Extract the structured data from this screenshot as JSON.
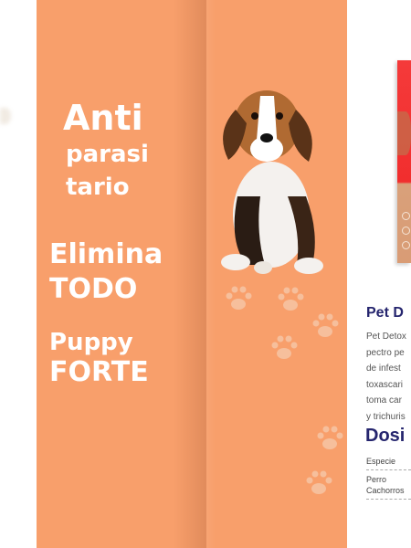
{
  "left_panel": {
    "headline_1": "Anti",
    "headline_2": "parasi",
    "headline_3": "tario",
    "headline_4": "Elimina",
    "headline_5": "TODO",
    "headline_6": "Puppy",
    "headline_7": "FORTE",
    "background_color": "#f89f6b"
  },
  "product": {
    "title": "Pet D",
    "description_lines": [
      "Pet Detox",
      "pectro pe",
      "de  infest",
      "toxascari",
      "toma car",
      "y trichuris"
    ],
    "dosage_title": "Dosi",
    "table": {
      "header": "Especie",
      "rows": [
        "Perro",
        "Cachorros"
      ]
    },
    "title_color": "#25256e"
  }
}
